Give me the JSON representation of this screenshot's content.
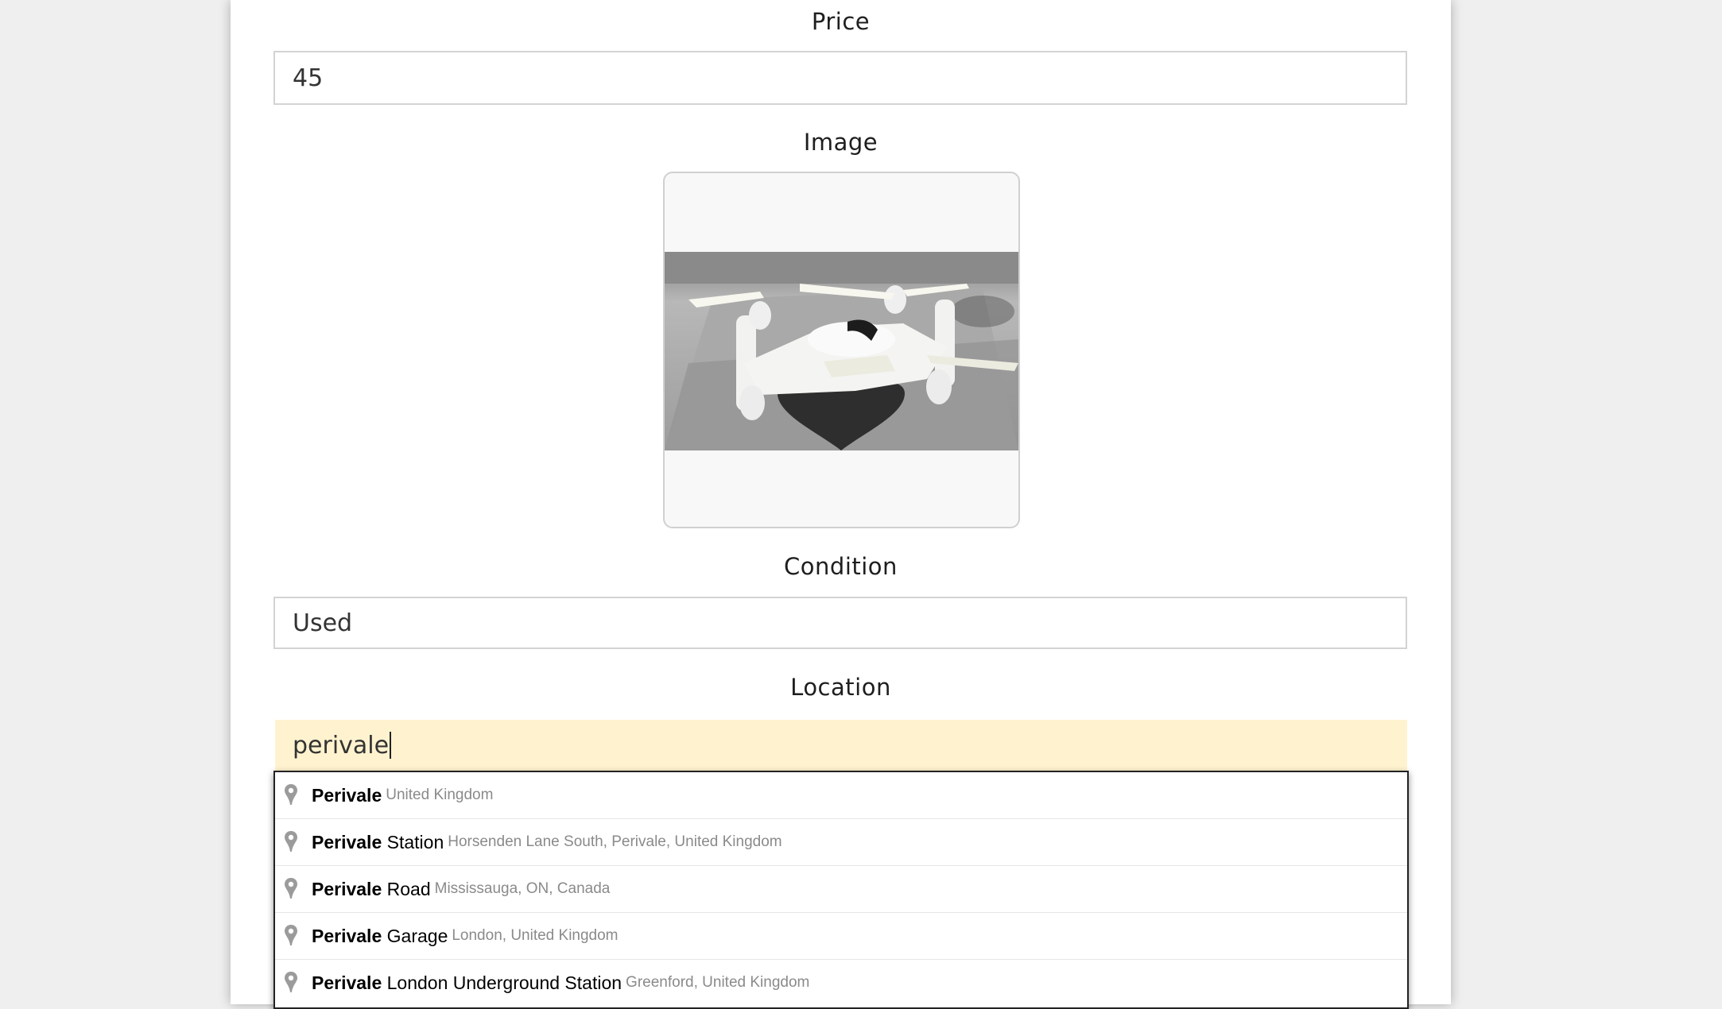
{
  "form": {
    "price": {
      "label": "Price",
      "value": "45"
    },
    "image": {
      "label": "Image",
      "alt": "drone photo"
    },
    "condition": {
      "label": "Condition",
      "value": "Used"
    },
    "location": {
      "label": "Location",
      "value": "perivale"
    }
  },
  "autocomplete": {
    "items": [
      {
        "match": "Perivale",
        "rest": "",
        "secondary": "United Kingdom"
      },
      {
        "match": "Perivale",
        "rest": " Station",
        "secondary": "Horsenden Lane South, Perivale, United Kingdom"
      },
      {
        "match": "Perivale",
        "rest": " Road",
        "secondary": "Mississauga, ON, Canada"
      },
      {
        "match": "Perivale",
        "rest": " Garage",
        "secondary": "London, United Kingdom"
      },
      {
        "match": "Perivale",
        "rest": " London Underground Station",
        "secondary": "Greenford, United Kingdom"
      }
    ],
    "icon": "map-pin-icon"
  },
  "colors": {
    "page_bg": "#efefef",
    "card_bg": "#ffffff",
    "active_input_bg": "#fff3cf",
    "secondary_text": "#8a8a8a"
  }
}
